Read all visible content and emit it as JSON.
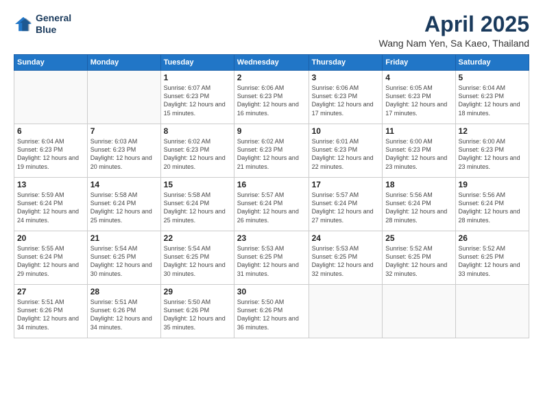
{
  "logo": {
    "line1": "General",
    "line2": "Blue"
  },
  "title": "April 2025",
  "subtitle": "Wang Nam Yen, Sa Kaeo, Thailand",
  "headers": [
    "Sunday",
    "Monday",
    "Tuesday",
    "Wednesday",
    "Thursday",
    "Friday",
    "Saturday"
  ],
  "weeks": [
    [
      {
        "day": "",
        "sunrise": "",
        "sunset": "",
        "daylight": "",
        "empty": true
      },
      {
        "day": "",
        "sunrise": "",
        "sunset": "",
        "daylight": "",
        "empty": true
      },
      {
        "day": "1",
        "sunrise": "Sunrise: 6:07 AM",
        "sunset": "Sunset: 6:23 PM",
        "daylight": "Daylight: 12 hours and 15 minutes."
      },
      {
        "day": "2",
        "sunrise": "Sunrise: 6:06 AM",
        "sunset": "Sunset: 6:23 PM",
        "daylight": "Daylight: 12 hours and 16 minutes."
      },
      {
        "day": "3",
        "sunrise": "Sunrise: 6:06 AM",
        "sunset": "Sunset: 6:23 PM",
        "daylight": "Daylight: 12 hours and 17 minutes."
      },
      {
        "day": "4",
        "sunrise": "Sunrise: 6:05 AM",
        "sunset": "Sunset: 6:23 PM",
        "daylight": "Daylight: 12 hours and 17 minutes."
      },
      {
        "day": "5",
        "sunrise": "Sunrise: 6:04 AM",
        "sunset": "Sunset: 6:23 PM",
        "daylight": "Daylight: 12 hours and 18 minutes."
      }
    ],
    [
      {
        "day": "6",
        "sunrise": "Sunrise: 6:04 AM",
        "sunset": "Sunset: 6:23 PM",
        "daylight": "Daylight: 12 hours and 19 minutes."
      },
      {
        "day": "7",
        "sunrise": "Sunrise: 6:03 AM",
        "sunset": "Sunset: 6:23 PM",
        "daylight": "Daylight: 12 hours and 20 minutes."
      },
      {
        "day": "8",
        "sunrise": "Sunrise: 6:02 AM",
        "sunset": "Sunset: 6:23 PM",
        "daylight": "Daylight: 12 hours and 20 minutes."
      },
      {
        "day": "9",
        "sunrise": "Sunrise: 6:02 AM",
        "sunset": "Sunset: 6:23 PM",
        "daylight": "Daylight: 12 hours and 21 minutes."
      },
      {
        "day": "10",
        "sunrise": "Sunrise: 6:01 AM",
        "sunset": "Sunset: 6:23 PM",
        "daylight": "Daylight: 12 hours and 22 minutes."
      },
      {
        "day": "11",
        "sunrise": "Sunrise: 6:00 AM",
        "sunset": "Sunset: 6:23 PM",
        "daylight": "Daylight: 12 hours and 23 minutes."
      },
      {
        "day": "12",
        "sunrise": "Sunrise: 6:00 AM",
        "sunset": "Sunset: 6:23 PM",
        "daylight": "Daylight: 12 hours and 23 minutes."
      }
    ],
    [
      {
        "day": "13",
        "sunrise": "Sunrise: 5:59 AM",
        "sunset": "Sunset: 6:24 PM",
        "daylight": "Daylight: 12 hours and 24 minutes."
      },
      {
        "day": "14",
        "sunrise": "Sunrise: 5:58 AM",
        "sunset": "Sunset: 6:24 PM",
        "daylight": "Daylight: 12 hours and 25 minutes."
      },
      {
        "day": "15",
        "sunrise": "Sunrise: 5:58 AM",
        "sunset": "Sunset: 6:24 PM",
        "daylight": "Daylight: 12 hours and 25 minutes."
      },
      {
        "day": "16",
        "sunrise": "Sunrise: 5:57 AM",
        "sunset": "Sunset: 6:24 PM",
        "daylight": "Daylight: 12 hours and 26 minutes."
      },
      {
        "day": "17",
        "sunrise": "Sunrise: 5:57 AM",
        "sunset": "Sunset: 6:24 PM",
        "daylight": "Daylight: 12 hours and 27 minutes."
      },
      {
        "day": "18",
        "sunrise": "Sunrise: 5:56 AM",
        "sunset": "Sunset: 6:24 PM",
        "daylight": "Daylight: 12 hours and 28 minutes."
      },
      {
        "day": "19",
        "sunrise": "Sunrise: 5:56 AM",
        "sunset": "Sunset: 6:24 PM",
        "daylight": "Daylight: 12 hours and 28 minutes."
      }
    ],
    [
      {
        "day": "20",
        "sunrise": "Sunrise: 5:55 AM",
        "sunset": "Sunset: 6:24 PM",
        "daylight": "Daylight: 12 hours and 29 minutes."
      },
      {
        "day": "21",
        "sunrise": "Sunrise: 5:54 AM",
        "sunset": "Sunset: 6:25 PM",
        "daylight": "Daylight: 12 hours and 30 minutes."
      },
      {
        "day": "22",
        "sunrise": "Sunrise: 5:54 AM",
        "sunset": "Sunset: 6:25 PM",
        "daylight": "Daylight: 12 hours and 30 minutes."
      },
      {
        "day": "23",
        "sunrise": "Sunrise: 5:53 AM",
        "sunset": "Sunset: 6:25 PM",
        "daylight": "Daylight: 12 hours and 31 minutes."
      },
      {
        "day": "24",
        "sunrise": "Sunrise: 5:53 AM",
        "sunset": "Sunset: 6:25 PM",
        "daylight": "Daylight: 12 hours and 32 minutes."
      },
      {
        "day": "25",
        "sunrise": "Sunrise: 5:52 AM",
        "sunset": "Sunset: 6:25 PM",
        "daylight": "Daylight: 12 hours and 32 minutes."
      },
      {
        "day": "26",
        "sunrise": "Sunrise: 5:52 AM",
        "sunset": "Sunset: 6:25 PM",
        "daylight": "Daylight: 12 hours and 33 minutes."
      }
    ],
    [
      {
        "day": "27",
        "sunrise": "Sunrise: 5:51 AM",
        "sunset": "Sunset: 6:26 PM",
        "daylight": "Daylight: 12 hours and 34 minutes."
      },
      {
        "day": "28",
        "sunrise": "Sunrise: 5:51 AM",
        "sunset": "Sunset: 6:26 PM",
        "daylight": "Daylight: 12 hours and 34 minutes."
      },
      {
        "day": "29",
        "sunrise": "Sunrise: 5:50 AM",
        "sunset": "Sunset: 6:26 PM",
        "daylight": "Daylight: 12 hours and 35 minutes."
      },
      {
        "day": "30",
        "sunrise": "Sunrise: 5:50 AM",
        "sunset": "Sunset: 6:26 PM",
        "daylight": "Daylight: 12 hours and 36 minutes."
      },
      {
        "day": "",
        "sunrise": "",
        "sunset": "",
        "daylight": "",
        "empty": true
      },
      {
        "day": "",
        "sunrise": "",
        "sunset": "",
        "daylight": "",
        "empty": true
      },
      {
        "day": "",
        "sunrise": "",
        "sunset": "",
        "daylight": "",
        "empty": true
      }
    ]
  ]
}
